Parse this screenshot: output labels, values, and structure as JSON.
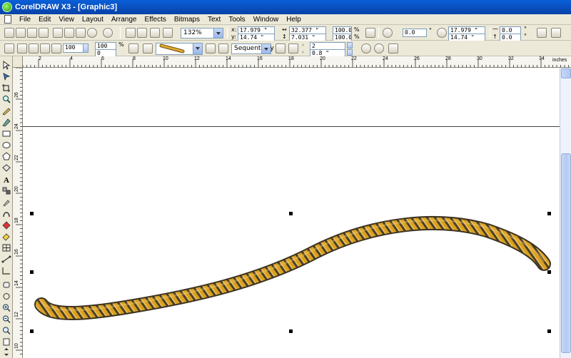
{
  "window": {
    "title": "CorelDRAW X3 - [Graphic3]"
  },
  "menu": [
    "File",
    "Edit",
    "View",
    "Layout",
    "Arrange",
    "Effects",
    "Bitmaps",
    "Text",
    "Tools",
    "Window",
    "Help"
  ],
  "toolbar": {
    "zoom": "132%",
    "x": "17.979 \"",
    "y": "14.74 \"",
    "width": "32.377 \"",
    "height": "7.031 \"",
    "scale_x": "100.0",
    "scale_y": "100.0",
    "scale_unit": "%",
    "angle": "0.0",
    "angle_unit": "°",
    "x2": "17.979 \"",
    "y2": "14.74 \"",
    "skew_h": "0.0",
    "skew_v": "0.0",
    "skew_unit": "°"
  },
  "property_bar": {
    "stroke_width": "100",
    "size_a": "100",
    "size_b": "0",
    "mode": "Sequentially",
    "spacing": "2",
    "offset": "0.8 \""
  },
  "ruler": {
    "unit": "inches",
    "h_labels": [
      "2",
      "4",
      "6",
      "8",
      "10",
      "12",
      "14",
      "16",
      "18",
      "20",
      "22",
      "24",
      "26",
      "28",
      "30",
      "32",
      "34"
    ],
    "v_labels": [
      "26",
      "24",
      "22",
      "20",
      "18",
      "16",
      "14",
      "12",
      "10"
    ]
  },
  "colors": {
    "rope_fill": "#d9a020",
    "rope_outline": "#4a3f2a",
    "titlebar": "#0a56d0"
  }
}
